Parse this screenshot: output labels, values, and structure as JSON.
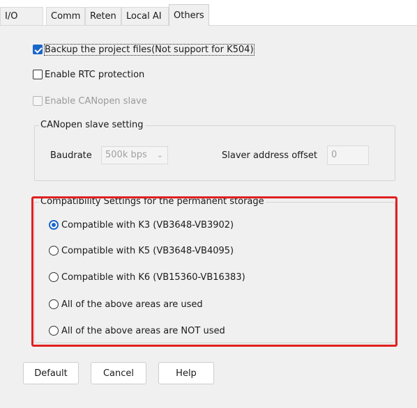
{
  "tabs": [
    {
      "label": "I/O"
    },
    {
      "label": "Comm"
    },
    {
      "label": "Reten"
    },
    {
      "label": "Local AI"
    },
    {
      "label": "Others",
      "active": true
    }
  ],
  "options": {
    "backup": {
      "label": "Backup the project files(Not support for K504)",
      "checked": true
    },
    "rtc": {
      "label": "Enable RTC protection",
      "checked": false
    },
    "canopen": {
      "label": "Enable CANopen slave",
      "checked": false,
      "disabled": true
    }
  },
  "canopen_group": {
    "title": "CANopen slave setting",
    "baudrate_label": "Baudrate",
    "baudrate_value": "500k bps",
    "offset_label": "Slaver address offset",
    "offset_value": "0"
  },
  "compat_group": {
    "title": "Compatibility Settings for the permanent storage",
    "options": [
      {
        "label": "Compatible with K3 (VB3648-VB3902)",
        "selected": true
      },
      {
        "label": "Compatible with K5 (VB3648-VB4095)",
        "selected": false
      },
      {
        "label": "Compatible with K6 (VB15360-VB16383)",
        "selected": false
      },
      {
        "label": "All of the above areas are used",
        "selected": false
      },
      {
        "label": "All of the above areas are NOT used",
        "selected": false
      }
    ]
  },
  "buttons": {
    "default": "Default",
    "cancel": "Cancel",
    "help": "Help"
  },
  "colors": {
    "accent": "#1a66c9",
    "highlight": "#e02020"
  }
}
